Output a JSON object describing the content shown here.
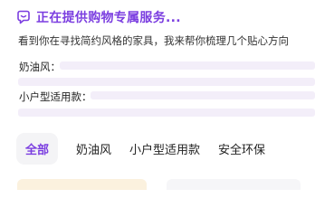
{
  "header": {
    "status_icon": "chat-bubble-icon",
    "title": "正在提供购物专属服务..."
  },
  "intro": {
    "text": "看到你在寻找简约风格的家具，我来帮你梳理几个贴心方向"
  },
  "sections": [
    {
      "label": "奶油风："
    },
    {
      "label": "小户型适用款："
    }
  ],
  "tabs": [
    {
      "label": "全部",
      "active": true
    },
    {
      "label": "奶油风",
      "active": false
    },
    {
      "label": "小户型适用款",
      "active": false
    },
    {
      "label": "安全环保",
      "active": false
    }
  ],
  "colors": {
    "accent": "#7b3ee0",
    "skeleton": "#f3eef9",
    "tab_active_bg": "#f4f4f6",
    "card_warm": "#fbf1de"
  }
}
